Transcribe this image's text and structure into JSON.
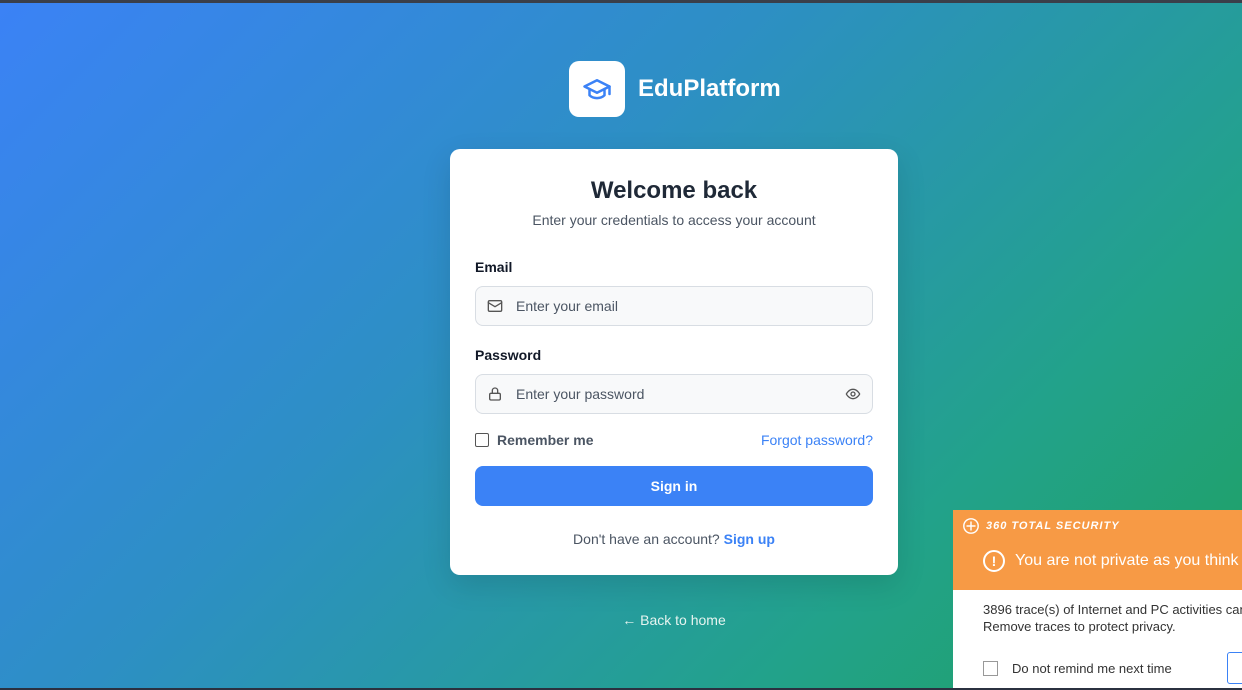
{
  "brand": {
    "name": "EduPlatform",
    "icon": "graduation-cap-icon"
  },
  "card": {
    "title": "Welcome back",
    "subtitle": "Enter your credentials to access your account",
    "email": {
      "label": "Email",
      "placeholder": "Enter your email",
      "value": ""
    },
    "password": {
      "label": "Password",
      "placeholder": "Enter your password",
      "value": ""
    },
    "remember_label": "Remember me",
    "remember_checked": false,
    "forgot_label": "Forgot password?",
    "signin_label": "Sign in",
    "signup_prompt": "Don't have an account?",
    "signup_link": "Sign up"
  },
  "back_link": "← Back to home",
  "popup": {
    "brand": "360 TOTAL SECURITY",
    "warning": "You are not private as you think",
    "body_line1": "3896 trace(s) of Internet and PC activities can",
    "body_line2": "Remove traces to protect privacy.",
    "remind_label": "Do not remind me next time"
  },
  "colors": {
    "accent": "#3b82f6",
    "popup_header": "#f79a45"
  }
}
